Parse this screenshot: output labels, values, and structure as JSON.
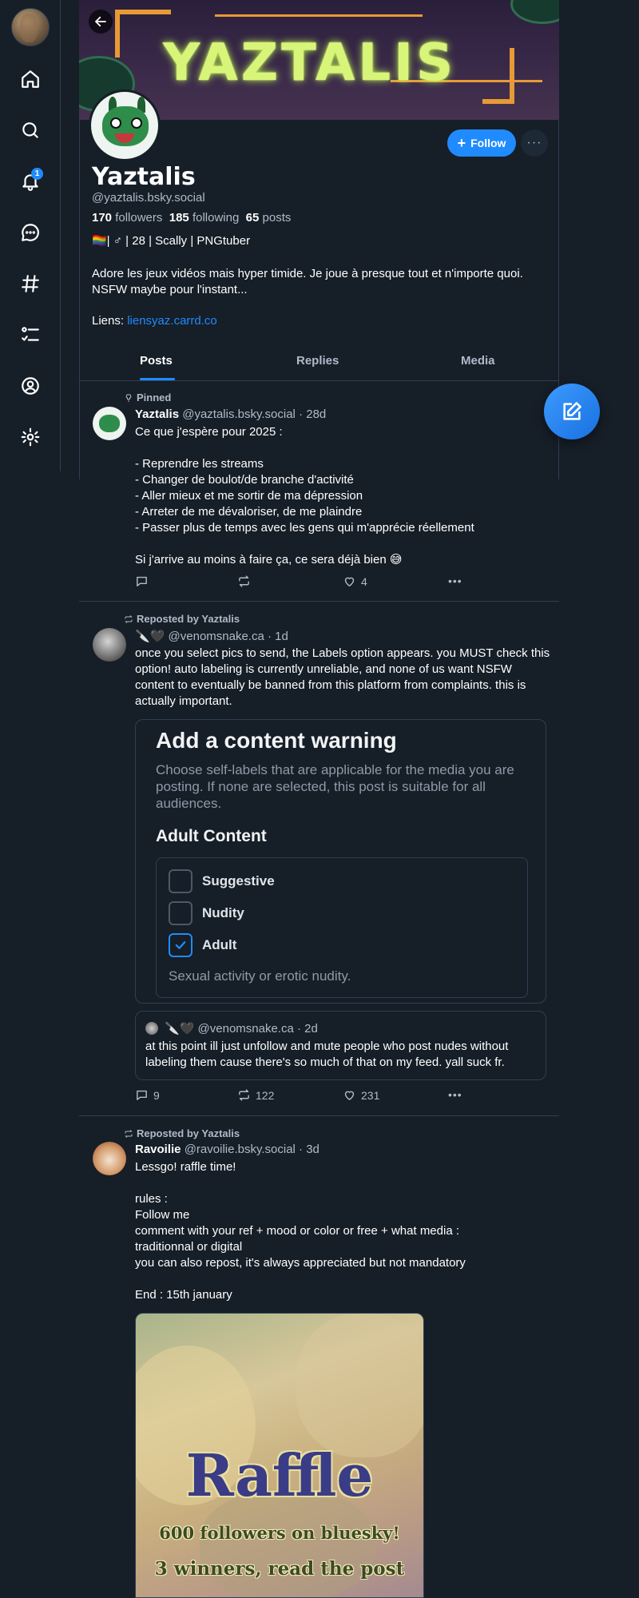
{
  "nav": {
    "notification_count": "1"
  },
  "profile": {
    "banner_text": "YAZTALIS",
    "follow_label": "Follow",
    "more_label": "···",
    "display_name": "Yaztalis",
    "handle": "@yaztalis.bsky.social",
    "followers_count": "170",
    "followers_label": "followers",
    "following_count": "185",
    "following_label": "following",
    "posts_count": "65",
    "posts_label": "posts",
    "tags": "🏳️‍🌈| ♂ | 28 | Scally | PNGtuber",
    "bio": "Adore les jeux vidéos mais hyper timide. Je joue à presque tout et n'importe quoi. NSFW maybe pour l'instant...",
    "links_label": "Liens:",
    "link_text": "liensyaz.carrd.co"
  },
  "tabs": [
    "Posts",
    "Replies",
    "Media"
  ],
  "posts": [
    {
      "context": "Pinned",
      "author": "Yaztalis",
      "handle": "@yaztalis.bsky.social",
      "age": "· 28d",
      "text": "Ce que j'espère pour 2025 :\n\n- Reprendre les streams\n- Changer de boulot/de branche d'activité\n- Aller mieux et me sortir de ma dépression\n- Arreter de me dévaloriser, de me plaindre\n- Passer plus de temps avec les gens qui m'apprécie réellement\n\nSi j'arrive au moins à faire ça, ce sera déjà bien 😅",
      "replies": "",
      "reposts": "",
      "likes": "4"
    },
    {
      "context": "Reposted by Yaztalis",
      "author_emoji": "🔪🖤",
      "handle": "@venomsnake.ca",
      "age": "· 1d",
      "text": "once you select pics to send, the Labels option appears. you MUST check this option! auto labeling is currently unreliable, and none of us want NSFW content to eventually be banned from this platform from complaints. this is actually important.",
      "embed": {
        "title": "Add a content warning",
        "description": "Choose self-labels that are applicable for the media you are posting. If none are selected, this post is suitable for all audiences.",
        "section": "Adult Content",
        "options": [
          "Suggestive",
          "Nudity",
          "Adult"
        ],
        "checked": "Adult",
        "note": "Sexual activity or erotic nudity."
      },
      "quote": {
        "author_emoji": "🔪🖤",
        "handle": "@venomsnake.ca",
        "age": "· 2d",
        "text": "at this point ill just unfollow and mute people who post nudes without labeling them cause there's so much of that on my feed. yall suck fr."
      },
      "replies": "9",
      "reposts": "122",
      "likes": "231"
    },
    {
      "context": "Reposted by Yaztalis",
      "author": "Ravoilie",
      "handle": "@ravoilie.bsky.social",
      "age": "· 3d",
      "text": "Lessgo! raffle time!\n\nrules :\nFollow me\ncomment with your ref + mood or color or free + what media :\ntraditionnal or digital\nyou can also repost, it's always appreciated but not mandatory\n\nEnd : 15th january",
      "image": {
        "title": "Raffle",
        "line1": "600 followers on bluesky!",
        "line2": "3 winners, read the post"
      }
    }
  ]
}
